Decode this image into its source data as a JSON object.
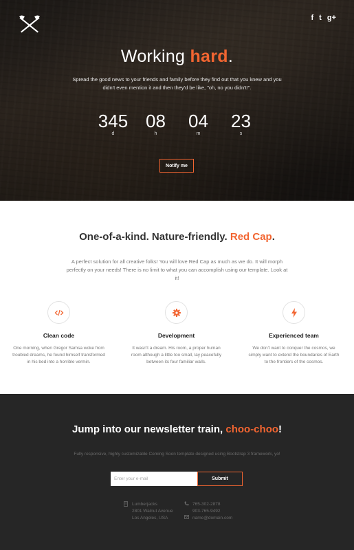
{
  "hero": {
    "title_plain": "Working",
    "title_accent": "hard",
    "title_end": ".",
    "subtitle": "Spread the good news to your friends and family before they find out that you knew and you didn't even mention it and then they'd be like, \"oh, no you didn't!\".",
    "countdown": [
      {
        "value": "345",
        "unit": "d"
      },
      {
        "value": "08",
        "unit": "h"
      },
      {
        "value": "04",
        "unit": "m"
      },
      {
        "value": "23",
        "unit": "s"
      }
    ],
    "notify_label": "Notify me",
    "social": [
      "f",
      "t",
      "g+"
    ]
  },
  "about": {
    "title_plain": "One-of-a-kind. Nature-friendly.",
    "title_accent": "Red Cap",
    "title_end": ".",
    "text": "A perfect solution for all creative folks! You will love Red Cap as much as we do. It will morph perfectly on your needs! There is no limit to what you can accomplish using our template. Look at it!",
    "features": [
      {
        "icon": "code-icon",
        "title": "Clean code",
        "text": "One morning, when Gregor Samsa woke from troubled dreams, he found himself transformed in his bed into a horrible vermin."
      },
      {
        "icon": "gear-icon",
        "title": "Development",
        "text": "It wasn't a dream. His room, a proper human room although a little too small, lay peacefully between its four familiar walls."
      },
      {
        "icon": "bolt-icon",
        "title": "Experienced team",
        "text": "We don't want to conquer the cosmos, we simply want to extend the boundaries of Earth to the frontiers of the cosmos."
      }
    ]
  },
  "newsletter": {
    "title_plain": "Jump into our newsletter train,",
    "title_accent": "choo-choo",
    "title_end": "!",
    "subtitle": "Fully responsive, highly customizable Coming Soon template designed using Bootstrap 3 framework, yo!",
    "email_placeholder": "Enter your e-mail",
    "submit_label": "Submit"
  },
  "contact": {
    "address": [
      "Lumberjacks",
      "2801 Walnut Avenue",
      "Los Angeles, USA"
    ],
    "phones": [
      "765-302-2878",
      "903-765-9492"
    ],
    "email": "name@domain.com"
  },
  "colors": {
    "accent": "#f26531",
    "dark": "#262626"
  }
}
